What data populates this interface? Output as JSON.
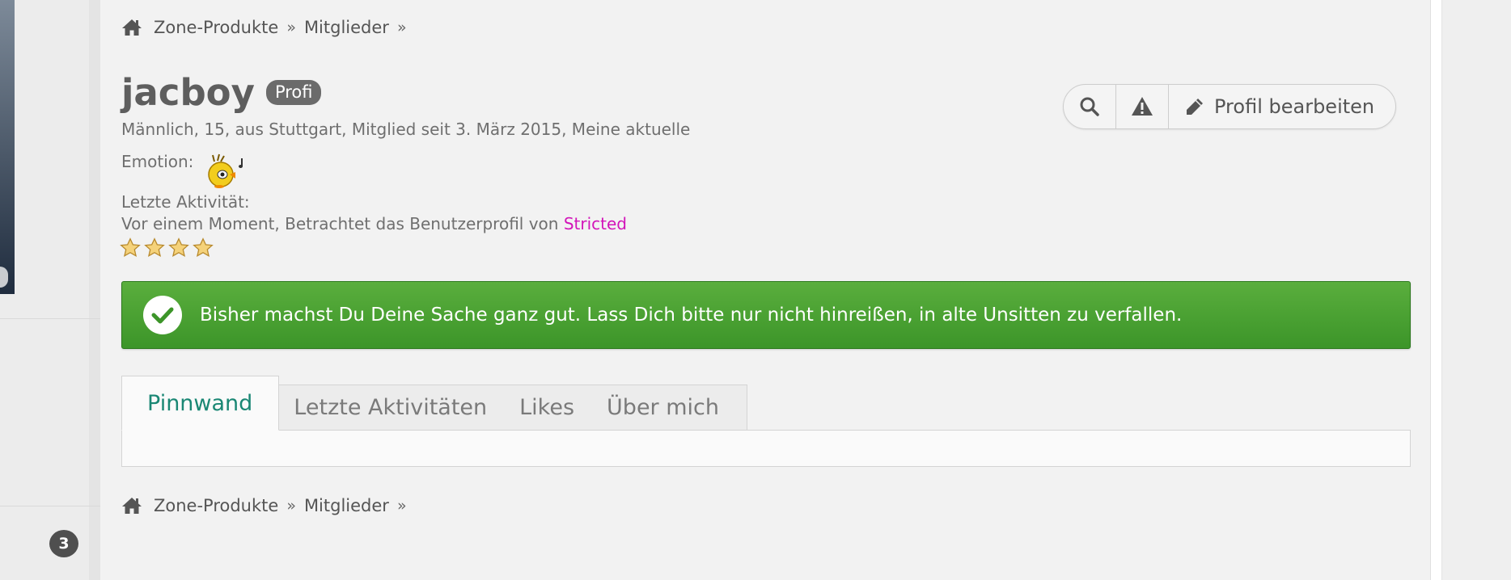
{
  "breadcrumb": {
    "items": [
      "Zone-Produkte",
      "Mitglieder"
    ],
    "separator": "»"
  },
  "profile": {
    "username": "jacboy",
    "rank": "Profi",
    "info": "Männlich, 15, aus Stuttgart, Mitglied seit 3. März 2015, Meine aktuelle",
    "emotion_label": "Emotion:",
    "activity_label": "Letzte Aktivität:",
    "activity_text": "Vor einem Moment, Betrachtet das Benutzerprofil von ",
    "activity_link": "Stricted",
    "stars": 4
  },
  "actions": {
    "edit_label": "Profil bearbeiten",
    "icons": [
      "search-icon",
      "warning-icon",
      "pencil-icon"
    ]
  },
  "notice": {
    "text": "Bisher machst Du Deine Sache ganz gut. Lass Dich bitte nur nicht hinreißen, in alte Unsitten zu verfallen."
  },
  "tabs": [
    "Pinnwand",
    "Letzte Aktivitäten",
    "Likes",
    "Über mich"
  ],
  "sidebar": {
    "badge_count": "3"
  },
  "colors": {
    "accent_tab": "#1a8774",
    "link": "#d214b9",
    "success": "#4ba235",
    "badge": "#6b6b6b"
  }
}
